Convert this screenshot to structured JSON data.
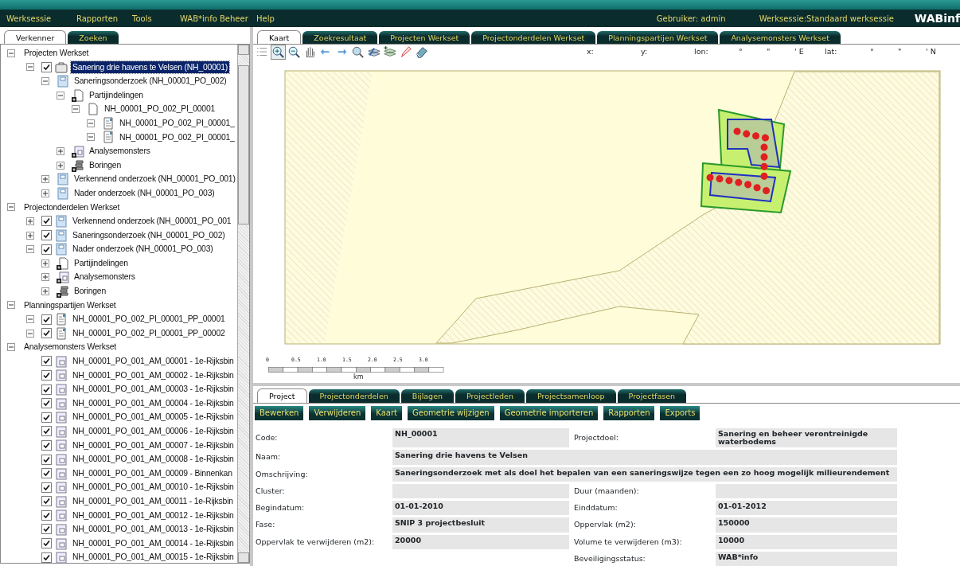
{
  "menu": {
    "items": [
      "Werksessie",
      "Rapporten",
      "Tools",
      "WAB*info Beheer",
      "Help"
    ],
    "user": "Gebruiker: admin",
    "session": "Werksessie:Standaard werksessie",
    "logo": "WABinf"
  },
  "left_tabs": [
    {
      "label": "Verkenner",
      "selected": true
    },
    {
      "label": "Zoeken",
      "selected": false
    }
  ],
  "tree": {
    "items": [
      {
        "label": "Projecten Werkset",
        "kind": "section",
        "expanded": true,
        "selected": false,
        "children": [
          {
            "label": "Sanering drie havens te Velsen (NH_00001)",
            "kind": "project",
            "expanded": true,
            "checked": true,
            "selected": true,
            "children": [
              {
                "label": "Saneringsonderzoek (NH_00001_PO_002)",
                "kind": "part",
                "expanded": true,
                "selected": false,
                "children": [
                  {
                    "label": "Partijindelingen",
                    "kind": "partij-folder",
                    "expanded": true,
                    "selected": false,
                    "children": [
                      {
                        "label": "NH_00001_PO_002_PI_00001",
                        "kind": "partij",
                        "expanded": true,
                        "selected": false,
                        "children": [
                          {
                            "label": "NH_00001_PO_002_PI_00001_",
                            "kind": "plan",
                            "expanded": true,
                            "selected": false
                          },
                          {
                            "label": "NH_00001_PO_002_PI_00001_",
                            "kind": "plan",
                            "expanded": true,
                            "selected": false
                          }
                        ]
                      }
                    ]
                  },
                  {
                    "label": "Analysemonsters",
                    "kind": "samples-folder",
                    "expanded": false,
                    "selected": false
                  },
                  {
                    "label": "Boringen",
                    "kind": "boring-folder",
                    "expanded": false,
                    "selected": false
                  }
                ]
              },
              {
                "label": "Verkennend onderzoek (NH_00001_PO_001)",
                "kind": "part",
                "expanded": false,
                "selected": false
              },
              {
                "label": "Nader onderzoek (NH_00001_PO_003)",
                "kind": "part",
                "expanded": false,
                "selected": false
              }
            ]
          }
        ]
      },
      {
        "label": "Projectonderdelen Werkset",
        "kind": "section",
        "expanded": true,
        "selected": false,
        "children": [
          {
            "label": "Verkennend onderzoek (NH_00001_PO_001",
            "kind": "part",
            "expanded": false,
            "checked": true,
            "selected": false
          },
          {
            "label": "Saneringsonderzoek (NH_00001_PO_002)",
            "kind": "part",
            "expanded": false,
            "checked": true,
            "selected": false
          },
          {
            "label": "Nader onderzoek (NH_00001_PO_003)",
            "kind": "part",
            "expanded": true,
            "checked": true,
            "selected": false,
            "children": [
              {
                "label": "Partijindelingen",
                "kind": "partij-folder",
                "expanded": false,
                "selected": false
              },
              {
                "label": "Analysemonsters",
                "kind": "samples-folder",
                "expanded": false,
                "selected": false
              },
              {
                "label": "Boringen",
                "kind": "boring-folder",
                "expanded": false,
                "selected": false
              }
            ]
          }
        ]
      },
      {
        "label": "Planningspartijen Werkset",
        "kind": "section",
        "expanded": true,
        "selected": false,
        "children": [
          {
            "label": "NH_00001_PO_002_PI_00001_PP_00001",
            "kind": "plan",
            "expanded": true,
            "checked": true,
            "selected": false
          },
          {
            "label": "NH_00001_PO_002_PI_00001_PP_00002",
            "kind": "plan",
            "expanded": true,
            "checked": true,
            "selected": false
          }
        ]
      },
      {
        "label": "Analysemonsters Werkset",
        "kind": "section",
        "expanded": true,
        "selected": false,
        "children": [
          {
            "label": "NH_00001_PO_001_AM_00001 - 1e-Rijksbin",
            "kind": "sample",
            "checked": true,
            "selected": false
          },
          {
            "label": "NH_00001_PO_001_AM_00002 - 1e-Rijksbin",
            "kind": "sample",
            "checked": true,
            "selected": false
          },
          {
            "label": "NH_00001_PO_001_AM_00003 - 1e-Rijksbin",
            "kind": "sample",
            "checked": true,
            "selected": false
          },
          {
            "label": "NH_00001_PO_001_AM_00004 - 1e-Rijksbin",
            "kind": "sample",
            "checked": true,
            "selected": false
          },
          {
            "label": "NH_00001_PO_001_AM_00005 - 1e-Rijksbin",
            "kind": "sample",
            "checked": true,
            "selected": false
          },
          {
            "label": "NH_00001_PO_001_AM_00006 - 1e-Rijksbin",
            "kind": "sample",
            "checked": true,
            "selected": false
          },
          {
            "label": "NH_00001_PO_001_AM_00007 - 1e-Rijksbin",
            "kind": "sample",
            "checked": true,
            "selected": false
          },
          {
            "label": "NH_00001_PO_001_AM_00008 - 1e-Rijksbin",
            "kind": "sample",
            "checked": true,
            "selected": false
          },
          {
            "label": "NH_00001_PO_001_AM_00009 - Binnenkan",
            "kind": "sample",
            "checked": true,
            "selected": false
          },
          {
            "label": "NH_00001_PO_001_AM_00010 - 1e-Rijksbin",
            "kind": "sample",
            "checked": true,
            "selected": false
          },
          {
            "label": "NH_00001_PO_001_AM_00011 - 1e-Rijksbin",
            "kind": "sample",
            "checked": true,
            "selected": false
          },
          {
            "label": "NH_00001_PO_001_AM_00012 - 1e-Rijksbin",
            "kind": "sample",
            "checked": true,
            "selected": false
          },
          {
            "label": "NH_00001_PO_001_AM_00013 - 1e-Rijksbin",
            "kind": "sample",
            "checked": true,
            "selected": false
          },
          {
            "label": "NH_00001_PO_001_AM_00014 - 1e-Rijksbin",
            "kind": "sample",
            "checked": true,
            "selected": false
          },
          {
            "label": "NH_00001_PO_001_AM_00015 - 1e-Rijksbin",
            "kind": "sample",
            "checked": true,
            "selected": false
          }
        ]
      }
    ]
  },
  "right_tabs": [
    {
      "label": "Kaart",
      "selected": true
    },
    {
      "label": "Zoekresultaat",
      "selected": false
    },
    {
      "label": "Projecten Werkset",
      "selected": false
    },
    {
      "label": "Projectonderdelen Werkset",
      "selected": false
    },
    {
      "label": "Planningspartijen Werkset",
      "selected": false
    },
    {
      "label": "Analysemonsters Werkset",
      "selected": false
    }
  ],
  "map_toolbar": {
    "tools": [
      {
        "kind": "list",
        "selected": false
      },
      {
        "kind": "zoom-in",
        "selected": true
      },
      {
        "kind": "zoom-out",
        "selected": false
      },
      {
        "kind": "pan",
        "selected": false
      },
      {
        "kind": "back",
        "selected": false
      },
      {
        "kind": "forward",
        "selected": false
      },
      {
        "kind": "find",
        "selected": false
      },
      {
        "kind": "layers",
        "selected": false
      },
      {
        "kind": "layers-add",
        "selected": false
      },
      {
        "kind": "pencil",
        "selected": false
      },
      {
        "kind": "eraser",
        "selected": false
      }
    ],
    "coords": [
      "x:",
      "y:",
      "lon:",
      "°",
      "\"",
      "' E",
      "lat:",
      "°",
      "\"",
      "' N"
    ]
  },
  "map": {
    "kind": "picture",
    "scale_labels": [
      "0",
      "0.5",
      "1.0",
      "1.5",
      "2.0",
      "2.5",
      "3.0"
    ],
    "scale_unit": "km"
  },
  "detail_tabs": [
    {
      "label": "Project",
      "selected": true
    },
    {
      "label": "Projectonderdelen",
      "selected": false
    },
    {
      "label": "Bijlagen",
      "selected": false
    },
    {
      "label": "Projectleden",
      "selected": false
    },
    {
      "label": "Projectsamenloop",
      "selected": false
    },
    {
      "label": "Projectfasen",
      "selected": false
    }
  ],
  "buttons": [
    "Bewerken",
    "Verwijderen",
    "Kaart",
    "Geometrie wijzigen",
    "Geometrie importeren",
    "Rapporten",
    "Exports"
  ],
  "form": {
    "rows": [
      {
        "kind": "pair",
        "fields": [
          {
            "label": "Code:",
            "value": "NH_00001"
          },
          {
            "label": "Projectdoel:",
            "value": "Sanering en beheer verontreinigde waterbodems"
          }
        ]
      },
      {
        "kind": "wide",
        "fields": [
          {
            "label": "Naam:",
            "value": "Sanering drie havens te Velsen"
          }
        ]
      },
      {
        "kind": "wide",
        "fields": [
          {
            "label": "Omschrijving:",
            "value": "Saneringsonderzoek met als doel het bepalen van een saneringswijze tegen een zo hoog mogelijk milieurendement"
          }
        ]
      },
      {
        "kind": "pair",
        "fields": [
          {
            "label": "Cluster:"
          },
          {
            "label": "Duur (maanden):"
          }
        ]
      },
      {
        "kind": "pair",
        "fields": [
          {
            "label": "Begindatum:",
            "value": "01-01-2010"
          },
          {
            "label": "Einddatum:",
            "value": "01-01-2012"
          }
        ]
      },
      {
        "kind": "pair",
        "fields": [
          {
            "label": "Fase:",
            "value": "SNIP 3 projectbesluit"
          },
          {
            "label": "Oppervlak (m2):",
            "value": "150000"
          }
        ]
      },
      {
        "kind": "pair",
        "fields": [
          {
            "label": "Oppervlak te verwijderen (m2):",
            "value": "20000"
          },
          {
            "label": "Volume te verwijderen (m3):",
            "value": "10000"
          }
        ]
      },
      {
        "kind": "right",
        "fields": [
          {
            "label": "Beveiligingsstatus:",
            "value": "WAB*info"
          }
        ]
      }
    ]
  }
}
